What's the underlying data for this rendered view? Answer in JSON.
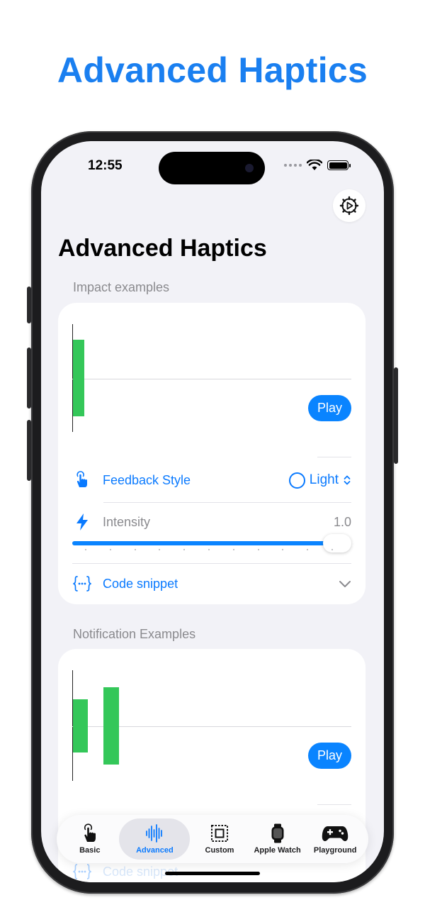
{
  "headline": "Advanced Haptics",
  "status_bar": {
    "time": "12:55"
  },
  "page": {
    "title": "Advanced Haptics"
  },
  "impact_section": {
    "label": "Impact examples",
    "play_label": "Play",
    "feedback_style": {
      "label": "Feedback Style",
      "value": "Light"
    },
    "intensity": {
      "label": "Intensity",
      "value_text": "1.0",
      "fraction": 1.0
    },
    "code_snippet_label": "Code snippet"
  },
  "notification_section": {
    "label": "Notification Examples",
    "play_label": "Play"
  },
  "ghost_row": {
    "label": "Code snippet"
  },
  "tab_bar": {
    "tabs": [
      {
        "label": "Basic",
        "icon": "hand-tap-icon",
        "active": false
      },
      {
        "label": "Advanced",
        "icon": "waveform-icon",
        "active": true
      },
      {
        "label": "Custom",
        "icon": "square-dashed-icon",
        "active": false
      },
      {
        "label": "Apple Watch",
        "icon": "applewatch-icon",
        "active": false
      },
      {
        "label": "Playground",
        "icon": "gamecontroller-icon",
        "active": false
      }
    ]
  },
  "colors": {
    "accent": "#0a84ff",
    "headline": "#1a7ff0",
    "bar": "#34c759",
    "background": "#f2f2f7"
  }
}
